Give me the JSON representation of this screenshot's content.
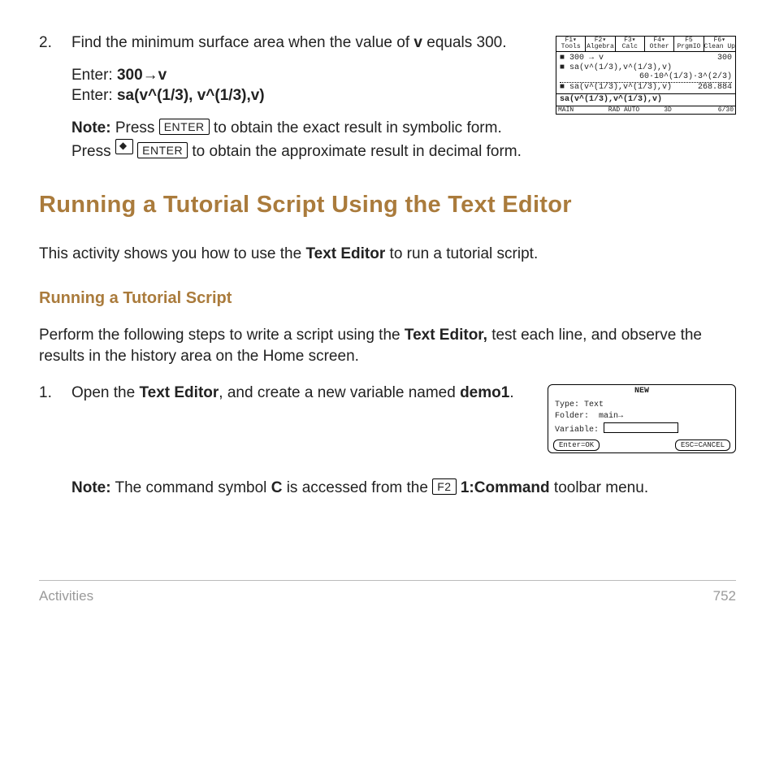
{
  "step2": {
    "num": "2.",
    "line1a": "Find the minimum surface area when the value of ",
    "line1_bold": "v",
    "line1b": " equals 300.",
    "enter1_prefix": "Enter: ",
    "enter1_bold": "300→v",
    "enter2_prefix": "Enter: ",
    "enter2_bold": "sa(v^(1/3), v^(1/3),v)",
    "note_label": "Note:",
    "note_a": " Press ",
    "enter_key": "ENTER",
    "note_b": " to obtain the exact result in symbolic form. Press ",
    "note_c": " to obtain the approximate result in decimal form."
  },
  "calc": {
    "menu": [
      "F1▾\nTools",
      "F2▾\nAlgebra",
      "F3▾\nCalc",
      "F4▾\nOther",
      "F5\nPrgmIO",
      "F6▾\nClean Up"
    ],
    "rows": [
      {
        "left": "■ 300 → v",
        "right": "300"
      },
      {
        "left": "■ sa(v^(1/3),v^(1/3),v)",
        "right": ""
      },
      {
        "left": "",
        "right": "60·10^(1/3)·3^(2/3)"
      },
      {
        "left": "■ sa(v^(1/3),v^(1/3),v)",
        "right": "268.884"
      }
    ],
    "entry": "sa(v^(1/3),v^(1/3),v)",
    "status": [
      "MAIN",
      "RAD AUTO",
      "3D",
      "6/30"
    ]
  },
  "heading": "Running a Tutorial Script Using the Text Editor",
  "intro_a": "This activity shows you how to use the ",
  "intro_bold": "Text Editor",
  "intro_b": " to run a tutorial script.",
  "sub": "Running a Tutorial Script",
  "para2_a": "Perform the following steps to write a script using the ",
  "para2_bold": "Text Editor,",
  "para2_b": " test each line, and observe the results in the history area on the Home screen.",
  "step1": {
    "num": "1.",
    "text_a": "Open the ",
    "bold1": "Text Editor",
    "text_b": ", and create a new variable named ",
    "bold2": "demo1",
    "text_c": "."
  },
  "dialog": {
    "title": "NEW",
    "type_label": "Type:",
    "type_value": "Text",
    "folder_label": "Folder:",
    "folder_value": "main→",
    "var_label": "Variable:",
    "ok": "Enter=OK",
    "cancel": "ESC=CANCEL"
  },
  "note2": {
    "label": "Note:",
    "a": " The command symbol ",
    "c": "C",
    "b": " is accessed from the ",
    "key": "F2",
    "d": " ",
    "bold": "1:Command",
    "e": " toolbar menu."
  },
  "footer": {
    "left": "Activities",
    "right": "752"
  }
}
